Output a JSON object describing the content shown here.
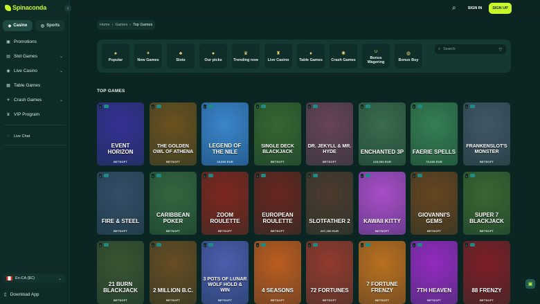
{
  "brand": {
    "name": "Spinaconda",
    "accent": "#c8f72a"
  },
  "sidebar": {
    "tabs": [
      {
        "label": "Casino",
        "icon": "casino-icon"
      },
      {
        "label": "Sports",
        "icon": "sports-icon"
      }
    ],
    "items": [
      {
        "label": "Promotions",
        "icon": "gift-icon",
        "expandable": false
      },
      {
        "label": "Slot Games",
        "icon": "slot-icon",
        "expandable": true
      },
      {
        "label": "Live Casino",
        "icon": "live-icon",
        "expandable": true
      },
      {
        "label": "Table Games",
        "icon": "table-icon",
        "expandable": false
      },
      {
        "label": "Crash Games",
        "icon": "crash-icon",
        "expandable": true
      },
      {
        "label": "VIP Program",
        "icon": "crown-icon",
        "expandable": false
      }
    ],
    "live_chat": "Live Chat",
    "language": "En-CA ($C)",
    "download": "Download App"
  },
  "header": {
    "sign_in": "SIGN IN",
    "sign_up": "SIGN UP"
  },
  "breadcrumb": [
    "Home",
    "Games",
    "Top Games"
  ],
  "categories": [
    {
      "label": "Popular",
      "icon": "cards-icon"
    },
    {
      "label": "New Games",
      "icon": "gift-icon"
    },
    {
      "label": "Slots",
      "icon": "slot-icon"
    },
    {
      "label": "Our picks",
      "icon": "coin-icon"
    },
    {
      "label": "Trending now",
      "icon": "crown-icon"
    },
    {
      "label": "Live Casino",
      "icon": "dealer-icon"
    },
    {
      "label": "Table Games",
      "icon": "cards-icon"
    },
    {
      "label": "Crash Games",
      "icon": "crash-icon"
    },
    {
      "label": "Bonus Wagering",
      "icon": "magnet-icon"
    },
    {
      "label": "Bonus Buy",
      "icon": "bag-icon"
    }
  ],
  "search": {
    "placeholder": "Search"
  },
  "section_title": "TOP GAMES",
  "games": [
    {
      "name": "Event Horizon",
      "provider": "BETSOFT",
      "jackpot": ""
    },
    {
      "name": "The Golden Owl of Athena",
      "provider": "BETSOFT",
      "jackpot": ""
    },
    {
      "name": "Legend of the Nile",
      "provider": "",
      "jackpot": "15,000 EUR"
    },
    {
      "name": "Single Deck Blackjack",
      "provider": "BETSOFT",
      "jackpot": ""
    },
    {
      "name": "Dr. Jekyll & Mr. Hyde",
      "provider": "BETSOFT",
      "jackpot": ""
    },
    {
      "name": "Enchanted 3P",
      "provider": "",
      "jackpot": "125,000 EUR"
    },
    {
      "name": "Faerie Spells",
      "provider": "",
      "jackpot": "75,000 EUR"
    },
    {
      "name": "Frankenslot's Monster",
      "provider": "BETSOFT",
      "jackpot": ""
    },
    {
      "name": "Fire & Steel",
      "provider": "BETSOFT",
      "jackpot": ""
    },
    {
      "name": "Caribbean Poker",
      "provider": "BETSOFT",
      "jackpot": ""
    },
    {
      "name": "Zoom Roulette",
      "provider": "BETSOFT",
      "jackpot": ""
    },
    {
      "name": "European Roulette",
      "provider": "BETSOFT",
      "jackpot": ""
    },
    {
      "name": "Slotfather 2",
      "provider": "",
      "jackpot": "267,250 EUR"
    },
    {
      "name": "Kawaii Kitty",
      "provider": "BETSOFT",
      "jackpot": ""
    },
    {
      "name": "Giovanni's Gems",
      "provider": "BETSOFT",
      "jackpot": ""
    },
    {
      "name": "Super 7 Blackjack",
      "provider": "BETSOFT",
      "jackpot": ""
    },
    {
      "name": "21 Burn Blackjack",
      "provider": "BETSOFT",
      "jackpot": ""
    },
    {
      "name": "2 Million B.C.",
      "provider": "BETSOFT",
      "jackpot": ""
    },
    {
      "name": "3 Pots of Lunar Wolf Hold & Win",
      "provider": "BETSOFT",
      "jackpot": ""
    },
    {
      "name": "4 Seasons",
      "provider": "BETSOFT",
      "jackpot": ""
    },
    {
      "name": "72 Fortunes",
      "provider": "BETSOFT",
      "jackpot": ""
    },
    {
      "name": "7 Fortune Frenzy",
      "provider": "BETSOFT",
      "jackpot": ""
    },
    {
      "name": "7th Heaven",
      "provider": "BETSOFT",
      "jackpot": ""
    },
    {
      "name": "88 Frenzy",
      "provider": "BETSOFT",
      "jackpot": ""
    }
  ],
  "tile_colors": [
    "#1c1a5a",
    "#3d2d10",
    "#1f4f8a",
    "#1d3a1a",
    "#3b2432",
    "#1f3d2a",
    "#1d4a2e",
    "#23303a",
    "#1c2a3c",
    "#1b3a22",
    "#4a1410",
    "#3a1410",
    "#2a1f18",
    "#6a2a88",
    "#3a2510",
    "#1f3a1a",
    "#1f2e1a",
    "#3a2a12",
    "#2a3470",
    "#7a3410",
    "#5a1f18",
    "#7a4010",
    "#5a1680",
    "#4a0f14"
  ]
}
